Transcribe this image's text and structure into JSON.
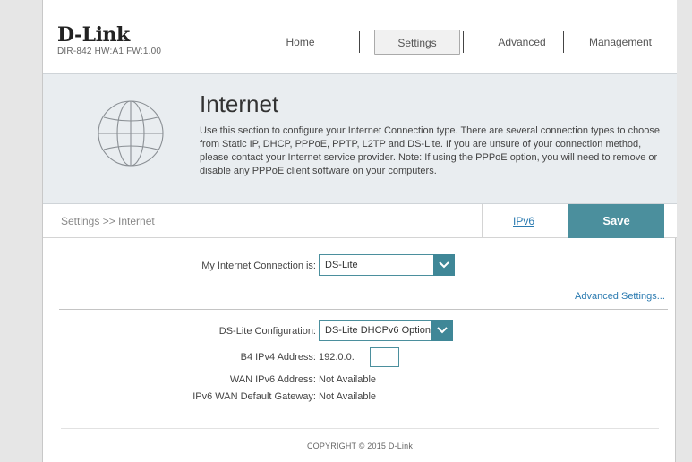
{
  "header": {
    "logo": "D-Link",
    "model_info": "DIR-842   HW:A1   FW:1.00",
    "nav": [
      {
        "label": "Home"
      },
      {
        "label": "Settings",
        "active": true
      },
      {
        "label": "Advanced"
      },
      {
        "label": "Management"
      }
    ]
  },
  "banner": {
    "icon": "globe-icon",
    "title": "Internet",
    "description": "Use this section to configure your Internet Connection type. There are several connection types to choose from Static IP, DHCP, PPPoE, PPTP, L2TP and DS-Lite. If you are unsure of your connection method, please contact your Internet service provider. Note: If using the PPPoE option, you will need to remove or disable any PPPoE client software on your computers."
  },
  "actionbar": {
    "breadcrumb": "Settings >> Internet",
    "ipv6_link": "IPv6",
    "save_label": "Save"
  },
  "form": {
    "connection_label": "My Internet Connection is:",
    "connection_value": "DS-Lite",
    "advanced_link": "Advanced Settings...",
    "dslite_config_label": "DS-Lite Configuration:",
    "dslite_config_value": "DS-Lite DHCPv6 Option",
    "b4_label": "B4 IPv4 Address:",
    "b4_prefix": "192.0.0.",
    "b4_value": "",
    "wan_ipv6_label": "WAN IPv6 Address:",
    "wan_ipv6_value": "Not Available",
    "gateway_label": "IPv6 WAN Default Gateway:",
    "gateway_value": "Not Available"
  },
  "footer": {
    "copyright": "COPYRIGHT © 2015 D-Link"
  },
  "colors": {
    "accent": "#4b8f9d",
    "link": "#2a7ab0",
    "banner_bg": "#e9edf0"
  }
}
